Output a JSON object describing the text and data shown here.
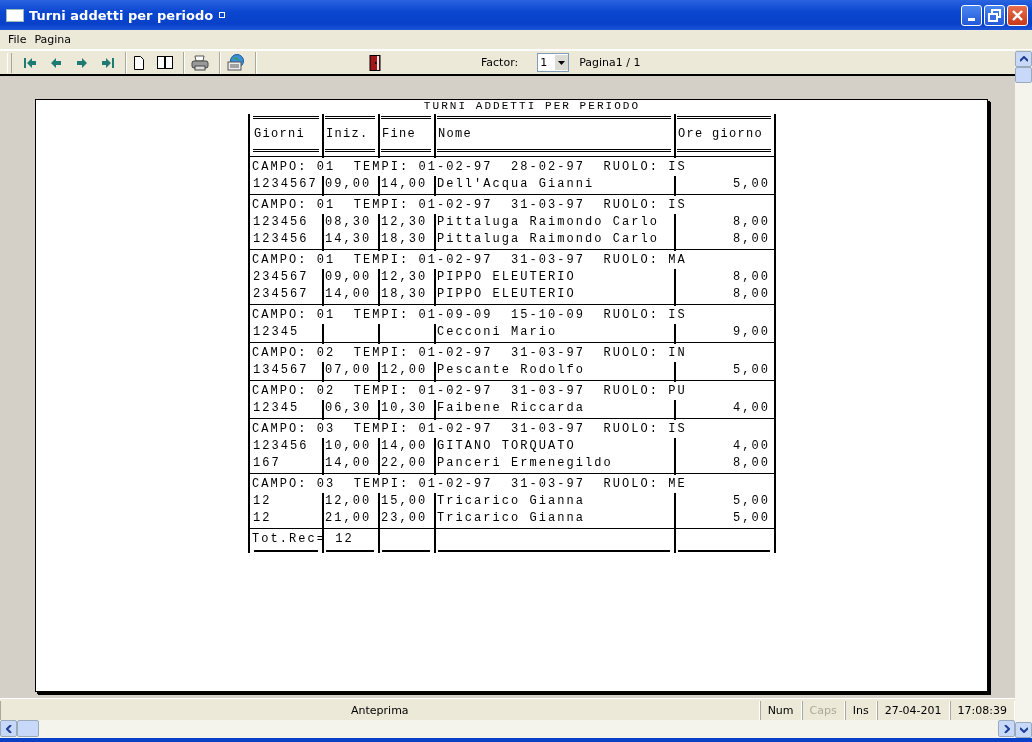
{
  "window": {
    "title": "Turni addetti per periodo"
  },
  "menu": [
    "File",
    "Pagina"
  ],
  "toolbar": {
    "factor_label": "Factor:",
    "factor_value": "1",
    "page_label": "Pagina1 / 1"
  },
  "report": {
    "title": "TURNI ADDETTI PER PERIODO",
    "columns": [
      "Giorni",
      "Iniz.",
      "Fine",
      "Nome",
      "Ore giorno"
    ],
    "groups": [
      {
        "header": "CAMPO: 01  TEMPI: 01-02-97  28-02-97  RUOLO: IS",
        "rows": [
          {
            "days": "1234567",
            "start": "09,00",
            "end": "14,00",
            "name": "Dell'Acqua Gianni",
            "hours": "5,00"
          }
        ]
      },
      {
        "header": "CAMPO: 01  TEMPI: 01-02-97  31-03-97  RUOLO: IS",
        "rows": [
          {
            "days": "123456",
            "start": "08,30",
            "end": "12,30",
            "name": "Pittaluga Raimondo Carlo",
            "hours": "8,00"
          },
          {
            "days": "123456",
            "start": "14,30",
            "end": "18,30",
            "name": "Pittaluga Raimondo Carlo",
            "hours": "8,00"
          }
        ]
      },
      {
        "header": "CAMPO: 01  TEMPI: 01-02-97  31-03-97  RUOLO: MA",
        "rows": [
          {
            "days": "234567",
            "start": "09,00",
            "end": "12,30",
            "name": "PIPPO ELEUTERIO",
            "hours": "8,00"
          },
          {
            "days": "234567",
            "start": "14,00",
            "end": "18,30",
            "name": "PIPPO ELEUTERIO",
            "hours": "8,00"
          }
        ]
      },
      {
        "header": "CAMPO: 01  TEMPI: 01-09-09  15-10-09  RUOLO: IS",
        "rows": [
          {
            "days": "12345",
            "name": "Cecconi Mario",
            "hours": "9,00"
          }
        ]
      },
      {
        "header": "CAMPO: 02  TEMPI: 01-02-97  31-03-97  RUOLO: IN",
        "rows": [
          {
            "days": "134567",
            "start": "07,00",
            "end": "12,00",
            "name": "Pescante Rodolfo",
            "hours": "5,00"
          }
        ]
      },
      {
        "header": "CAMPO: 02  TEMPI: 01-02-97  31-03-97  RUOLO: PU",
        "rows": [
          {
            "days": "12345",
            "start": "06,30",
            "end": "10,30",
            "name": "Faibene Riccarda",
            "hours": "4,00"
          }
        ]
      },
      {
        "header": "CAMPO: 03  TEMPI: 01-02-97  31-03-97  RUOLO: IS",
        "rows": [
          {
            "days": "123456",
            "start": "10,00",
            "end": "14,00",
            "name": "GITANO TORQUATO",
            "hours": "4,00"
          },
          {
            "days": "167",
            "start": "14,00",
            "end": "22,00",
            "name": "Panceri Ermenegildo",
            "hours": "8,00"
          }
        ]
      },
      {
        "header": "CAMPO: 03  TEMPI: 01-02-97  31-03-97  RUOLO: ME",
        "rows": [
          {
            "days": "12",
            "start": "12,00",
            "end": "15,00",
            "name": "Tricarico Gianna",
            "hours": "5,00"
          },
          {
            "days": "12",
            "start": "21,00",
            "end": "23,00",
            "name": "Tricarico Gianna",
            "hours": "5,00"
          }
        ]
      }
    ],
    "total": "Tot.Rec= 12"
  },
  "status_bar": [
    {
      "text": "Anteprima",
      "kind": "wide",
      "disabled": false
    },
    {
      "text": "Num",
      "kind": "small",
      "disabled": false
    },
    {
      "text": "Caps",
      "kind": "small",
      "disabled": true
    },
    {
      "text": "Ins",
      "kind": "small",
      "disabled": false
    },
    {
      "text": "27-04-201",
      "kind": "small",
      "disabled": false
    },
    {
      "text": "17:08:39",
      "kind": "small",
      "disabled": false
    }
  ]
}
